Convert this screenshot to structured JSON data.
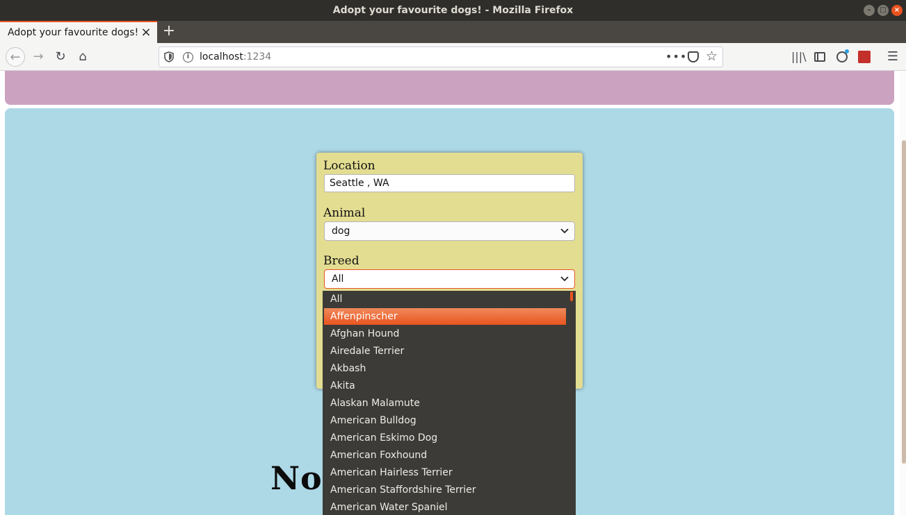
{
  "window": {
    "title": "Adopt your favourite dogs! - Mozilla Firefox",
    "controls": {
      "minimize": "–",
      "maximize": "□",
      "close": "×"
    }
  },
  "tab": {
    "title": "Adopt your favourite dogs!",
    "close": "×",
    "new_tab": "+"
  },
  "toolbar": {
    "back": "←",
    "forward": "→",
    "reload": "↻",
    "home": "⌂",
    "url_host": "localhost",
    "url_port": ":1234",
    "more": "•••",
    "star": "☆",
    "library": "|||\\",
    "menu": "☰"
  },
  "form": {
    "location_label": "Location",
    "location_value": "Seattle , WA",
    "animal_label": "Animal",
    "animal_value": "dog",
    "breed_label": "Breed",
    "breed_value": "All"
  },
  "breed_options": [
    "All",
    "Affenpinscher",
    "Afghan Hound",
    "Airedale Terrier",
    "Akbash",
    "Akita",
    "Alaskan Malamute",
    "American Bulldog",
    "American Eskimo Dog",
    "American Foxhound",
    "American Hairless Terrier",
    "American Staffordshire Terrier",
    "American Water Spaniel"
  ],
  "highlighted_option_index": 1,
  "heading": "No Pets Found!",
  "colors": {
    "accent": "#e95420",
    "header_band": "#cca2c1",
    "main_area": "#add8e6",
    "form_card": "#e3dd92",
    "dropdown_bg": "#3c3b37"
  }
}
